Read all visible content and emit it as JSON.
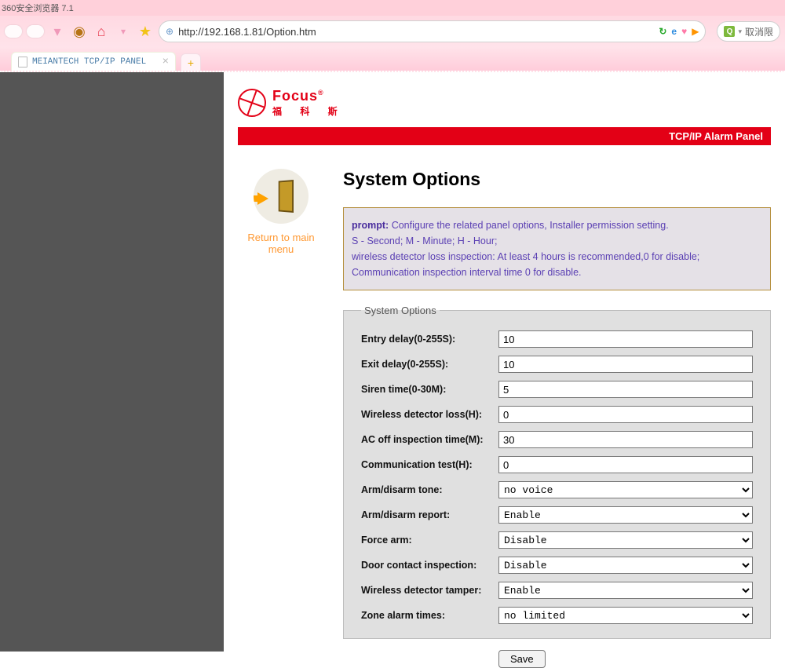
{
  "browser": {
    "title_fragment": "360安全浏览器 7.1",
    "url": "http://192.168.1.81/Option.htm",
    "tab_title": "MEIANTECH TCP/IP PANEL",
    "search_placeholder": "取消限"
  },
  "logo": {
    "en": "Focus",
    "cn": "福 科 斯"
  },
  "panel_bar_title": "TCP/IP Alarm Panel",
  "nav": {
    "return_label": "Return to main menu"
  },
  "page": {
    "heading": "System Options",
    "prompt_label": "prompt:",
    "prompt_line1": "Configure the related panel options, Installer permission setting.",
    "prompt_line2": "S - Second; M - Minute; H - Hour;",
    "prompt_line3": "wireless detector loss inspection: At least 4 hours is recommended,0 for disable;",
    "prompt_line4": "Communication inspection interval time 0 for disable."
  },
  "form": {
    "legend": "System Options",
    "labels": {
      "entry_delay": "Entry delay(0-255S):",
      "exit_delay": "Exit delay(0-255S):",
      "siren_time": "Siren time(0-30M):",
      "wireless_loss": "Wireless detector loss(H):",
      "ac_off": "AC off inspection time(M):",
      "comm_test": "Communication test(H):",
      "arm_tone": "Arm/disarm tone:",
      "arm_report": "Arm/disarm report:",
      "force_arm": "Force arm:",
      "door_inspection": "Door contact inspection:",
      "wireless_tamper": "Wireless detector tamper:",
      "zone_alarm": "Zone alarm times:"
    },
    "values": {
      "entry_delay": "10",
      "exit_delay": "10",
      "siren_time": "5",
      "wireless_loss": "0",
      "ac_off": "30",
      "comm_test": "0",
      "arm_tone": "no voice",
      "arm_report": "Enable",
      "force_arm": "Disable",
      "door_inspection": "Disable",
      "wireless_tamper": "Enable",
      "zone_alarm": "no limited"
    },
    "save_label": "Save"
  }
}
